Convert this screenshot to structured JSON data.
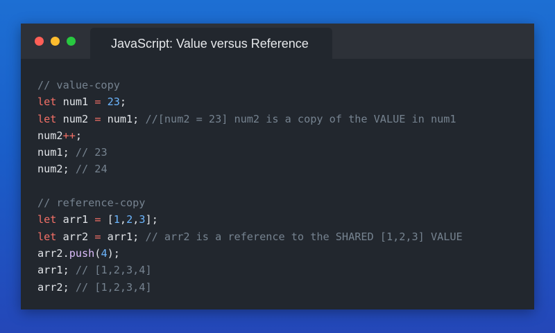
{
  "window": {
    "title": "JavaScript: Value versus Reference",
    "traffic_lights": [
      "close",
      "minimize",
      "maximize"
    ],
    "colors": {
      "close": "#ff5f57",
      "minimize": "#febc2e",
      "maximize": "#28c840",
      "editor_bg": "#22272e",
      "keyword": "#f47067",
      "number": "#6cb6ff",
      "comment": "#768390",
      "function": "#dcbdfb"
    }
  },
  "code": {
    "language": "javascript",
    "lines": [
      [
        {
          "t": "cm",
          "v": "// value-copy"
        }
      ],
      [
        {
          "t": "kw",
          "v": "let"
        },
        {
          "t": "tx",
          "v": " num1 "
        },
        {
          "t": "op",
          "v": "="
        },
        {
          "t": "tx",
          "v": " "
        },
        {
          "t": "num",
          "v": "23"
        },
        {
          "t": "tx",
          "v": ";"
        }
      ],
      [
        {
          "t": "kw",
          "v": "let"
        },
        {
          "t": "tx",
          "v": " num2 "
        },
        {
          "t": "op",
          "v": "="
        },
        {
          "t": "tx",
          "v": " num1; "
        },
        {
          "t": "cm",
          "v": "//[num2 = 23] num2 is a copy of the VALUE in num1"
        }
      ],
      [
        {
          "t": "tx",
          "v": "num2"
        },
        {
          "t": "op",
          "v": "++"
        },
        {
          "t": "tx",
          "v": ";"
        }
      ],
      [
        {
          "t": "tx",
          "v": "num1; "
        },
        {
          "t": "cm",
          "v": "// 23"
        }
      ],
      [
        {
          "t": "tx",
          "v": "num2; "
        },
        {
          "t": "cm",
          "v": "// 24"
        }
      ],
      [],
      [
        {
          "t": "cm",
          "v": "// reference-copy"
        }
      ],
      [
        {
          "t": "kw",
          "v": "let"
        },
        {
          "t": "tx",
          "v": " arr1 "
        },
        {
          "t": "op",
          "v": "="
        },
        {
          "t": "tx",
          "v": " ["
        },
        {
          "t": "num",
          "v": "1"
        },
        {
          "t": "tx",
          "v": ","
        },
        {
          "t": "num",
          "v": "2"
        },
        {
          "t": "tx",
          "v": ","
        },
        {
          "t": "num",
          "v": "3"
        },
        {
          "t": "tx",
          "v": "];"
        }
      ],
      [
        {
          "t": "kw",
          "v": "let"
        },
        {
          "t": "tx",
          "v": " arr2 "
        },
        {
          "t": "op",
          "v": "="
        },
        {
          "t": "tx",
          "v": " arr1; "
        },
        {
          "t": "cm",
          "v": "// arr2 is a reference to the SHARED [1,2,3] VALUE"
        }
      ],
      [
        {
          "t": "tx",
          "v": "arr2."
        },
        {
          "t": "fn",
          "v": "push"
        },
        {
          "t": "tx",
          "v": "("
        },
        {
          "t": "num",
          "v": "4"
        },
        {
          "t": "tx",
          "v": ");"
        }
      ],
      [
        {
          "t": "tx",
          "v": "arr1; "
        },
        {
          "t": "cm",
          "v": "// [1,2,3,4]"
        }
      ],
      [
        {
          "t": "tx",
          "v": "arr2; "
        },
        {
          "t": "cm",
          "v": "// [1,2,3,4]"
        }
      ]
    ]
  }
}
